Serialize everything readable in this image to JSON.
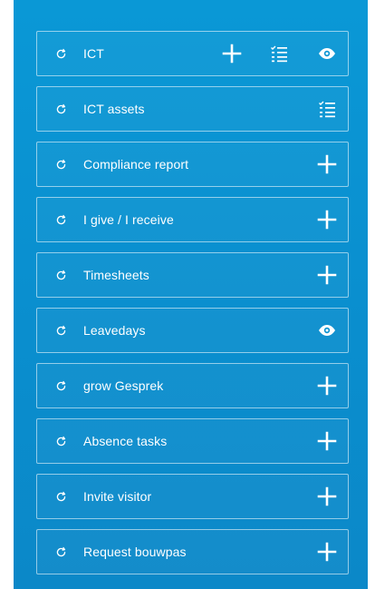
{
  "colors": {
    "panel_top": "#0a98d6",
    "panel_bottom": "#0b88c8",
    "tile_border": "rgba(255,255,255,0.55)",
    "foreground": "#ffffff"
  },
  "tiles": [
    {
      "label": "ICT",
      "icons": [
        "plus-icon",
        "checklist-icon",
        "eye-icon"
      ]
    },
    {
      "label": "ICT assets",
      "icons": [
        "checklist-icon"
      ]
    },
    {
      "label": "Compliance report",
      "icons": [
        "plus-icon"
      ]
    },
    {
      "label": "I give / I receive",
      "icons": [
        "plus-icon"
      ]
    },
    {
      "label": "Timesheets",
      "icons": [
        "plus-icon"
      ]
    },
    {
      "label": "Leavedays",
      "icons": [
        "eye-icon"
      ]
    },
    {
      "label": "grow Gesprek",
      "icons": [
        "plus-icon"
      ]
    },
    {
      "label": "Absence tasks",
      "icons": [
        "plus-icon"
      ]
    },
    {
      "label": "Invite visitor",
      "icons": [
        "plus-icon"
      ]
    },
    {
      "label": "Request bouwpas",
      "icons": [
        "plus-icon"
      ]
    }
  ]
}
